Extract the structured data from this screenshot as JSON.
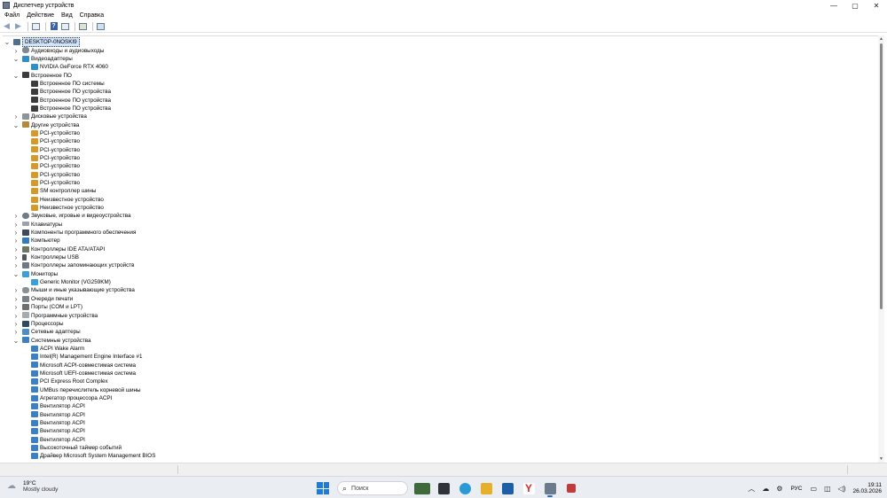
{
  "window": {
    "title": "Диспетчер устройств",
    "controls": {
      "minimize": "—",
      "maximize": "▢",
      "close": "✕"
    }
  },
  "menu": [
    "Файл",
    "Действие",
    "Вид",
    "Справка"
  ],
  "toolbar": {
    "buttons": [
      "back-icon",
      "forward-icon",
      "properties-icon",
      "help-icon",
      "view-icon",
      "update-driver-icon",
      "monitor-icon"
    ]
  },
  "tree": [
    {
      "label": "DESKTOP-0NOSKI9",
      "level": 0,
      "expander": "open",
      "icon": "root",
      "selected": true
    },
    {
      "label": "Аудиовходы и аудиовыходы",
      "level": 1,
      "expander": "closed",
      "icon": "audio"
    },
    {
      "label": "Видеоадаптеры",
      "level": 1,
      "expander": "open",
      "icon": "display"
    },
    {
      "label": "NVIDIA GeForce RTX 4060",
      "level": 2,
      "expander": "none",
      "icon": "display"
    },
    {
      "label": "Встроенное ПО",
      "level": 1,
      "expander": "open",
      "icon": "firmware"
    },
    {
      "label": "Встроенное ПО системы",
      "level": 2,
      "expander": "none",
      "icon": "firmware"
    },
    {
      "label": "Встроенное ПО устройства",
      "level": 2,
      "expander": "none",
      "icon": "firmware"
    },
    {
      "label": "Встроенное ПО устройства",
      "level": 2,
      "expander": "none",
      "icon": "firmware"
    },
    {
      "label": "Встроенное ПО устройства",
      "level": 2,
      "expander": "none",
      "icon": "firmware"
    },
    {
      "label": "Дисковые устройства",
      "level": 1,
      "expander": "closed",
      "icon": "disk"
    },
    {
      "label": "Другие устройства",
      "level": 1,
      "expander": "open",
      "icon": "other"
    },
    {
      "label": "PCI-устройство",
      "level": 2,
      "expander": "none",
      "icon": "warn"
    },
    {
      "label": "PCI-устройство",
      "level": 2,
      "expander": "none",
      "icon": "warn"
    },
    {
      "label": "PCI-устройство",
      "level": 2,
      "expander": "none",
      "icon": "warn"
    },
    {
      "label": "PCI-устройство",
      "level": 2,
      "expander": "none",
      "icon": "warn"
    },
    {
      "label": "PCI-устройство",
      "level": 2,
      "expander": "none",
      "icon": "warn"
    },
    {
      "label": "PCI-устройство",
      "level": 2,
      "expander": "none",
      "icon": "warn"
    },
    {
      "label": "PCI-устройство",
      "level": 2,
      "expander": "none",
      "icon": "warn"
    },
    {
      "label": "SM контроллер шины",
      "level": 2,
      "expander": "none",
      "icon": "warn"
    },
    {
      "label": "Неизвестное устройство",
      "level": 2,
      "expander": "none",
      "icon": "warn"
    },
    {
      "label": "Неизвестное устройство",
      "level": 2,
      "expander": "none",
      "icon": "warn"
    },
    {
      "label": "Звуковые, игровые и видеоустройства",
      "level": 1,
      "expander": "closed",
      "icon": "sound"
    },
    {
      "label": "Клавиатуры",
      "level": 1,
      "expander": "closed",
      "icon": "kbd"
    },
    {
      "label": "Компоненты программного обеспечения",
      "level": 1,
      "expander": "closed",
      "icon": "software"
    },
    {
      "label": "Компьютер",
      "level": 1,
      "expander": "closed",
      "icon": "computer"
    },
    {
      "label": "Контроллеры IDE ATA/ATAPI",
      "level": 1,
      "expander": "closed",
      "icon": "ide"
    },
    {
      "label": "Контроллеры USB",
      "level": 1,
      "expander": "closed",
      "icon": "usb"
    },
    {
      "label": "Контроллеры запоминающих устройств",
      "level": 1,
      "expander": "closed",
      "icon": "storage"
    },
    {
      "label": "Мониторы",
      "level": 1,
      "expander": "open",
      "icon": "monitor"
    },
    {
      "label": "Generic Monitor (VG259KM)",
      "level": 2,
      "expander": "none",
      "icon": "monitor"
    },
    {
      "label": "Мыши и иные указывающие устройства",
      "level": 1,
      "expander": "closed",
      "icon": "mouse"
    },
    {
      "label": "Очереди печати",
      "level": 1,
      "expander": "closed",
      "icon": "print"
    },
    {
      "label": "Порты (COM и LPT)",
      "level": 1,
      "expander": "closed",
      "icon": "port"
    },
    {
      "label": "Программные устройства",
      "level": 1,
      "expander": "closed",
      "icon": "progdev"
    },
    {
      "label": "Процессоры",
      "level": 1,
      "expander": "closed",
      "icon": "cpu"
    },
    {
      "label": "Сетевые адаптеры",
      "level": 1,
      "expander": "closed",
      "icon": "net"
    },
    {
      "label": "Системные устройства",
      "level": 1,
      "expander": "open",
      "icon": "sys"
    },
    {
      "label": "ACPI Wake Alarm",
      "level": 2,
      "expander": "none",
      "icon": "sys"
    },
    {
      "label": "Intel(R) Management Engine Interface #1",
      "level": 2,
      "expander": "none",
      "icon": "sys"
    },
    {
      "label": "Microsoft ACPI-совместимая система",
      "level": 2,
      "expander": "none",
      "icon": "sys"
    },
    {
      "label": "Microsoft UEFI-совместимая система",
      "level": 2,
      "expander": "none",
      "icon": "sys"
    },
    {
      "label": "PCI Express Root Complex",
      "level": 2,
      "expander": "none",
      "icon": "sys"
    },
    {
      "label": "UMBus перечислитель корневой шины",
      "level": 2,
      "expander": "none",
      "icon": "sys"
    },
    {
      "label": "Агрегатор процессора ACPI",
      "level": 2,
      "expander": "none",
      "icon": "sys"
    },
    {
      "label": "Вентилятор ACPI",
      "level": 2,
      "expander": "none",
      "icon": "sys"
    },
    {
      "label": "Вентилятор ACPI",
      "level": 2,
      "expander": "none",
      "icon": "sys"
    },
    {
      "label": "Вентилятор ACPI",
      "level": 2,
      "expander": "none",
      "icon": "sys"
    },
    {
      "label": "Вентилятор ACPI",
      "level": 2,
      "expander": "none",
      "icon": "sys"
    },
    {
      "label": "Вентилятор ACPI",
      "level": 2,
      "expander": "none",
      "icon": "sys"
    },
    {
      "label": "Высокоточный таймер событий",
      "level": 2,
      "expander": "none",
      "icon": "sys"
    },
    {
      "label": "Драйвер Microsoft System Management BIOS",
      "level": 2,
      "expander": "none",
      "icon": "sys"
    }
  ],
  "taskbar": {
    "weather": {
      "temp": "19°C",
      "condition": "Mostly cloudy",
      "icon": "cloud-icon"
    },
    "search_placeholder": "Поиск",
    "apps": [
      "start-icon",
      "search-icon",
      "widgets-icon",
      "taskview-icon",
      "edge-icon",
      "explorer-icon",
      "store-icon",
      "yandex-icon",
      "devmgr-icon",
      "app-icon"
    ],
    "tray": {
      "language": "РУС",
      "time": "19:11",
      "date": "26.03.2026"
    }
  },
  "colors": {
    "selection": "#cfe3fa",
    "accent": "#1f7ad8",
    "taskbar": "#eaeef2"
  }
}
